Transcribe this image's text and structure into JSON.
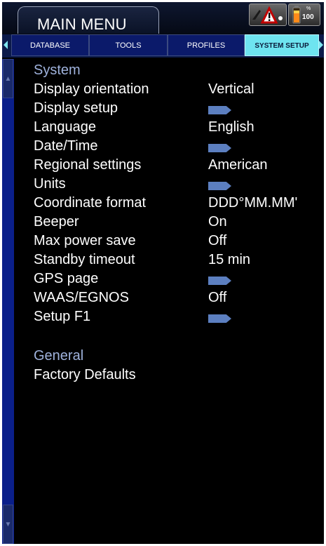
{
  "header": {
    "title": "MAIN MENU",
    "status_icons": [
      "warning-icon",
      "battery-icon"
    ],
    "battery_level": "100"
  },
  "tabs": [
    {
      "label": "DATABASE",
      "active": false
    },
    {
      "label": "TOOLS",
      "active": false
    },
    {
      "label": "PROFILES",
      "active": false
    },
    {
      "label": "SYSTEM SETUP",
      "active": true
    }
  ],
  "sections": {
    "system": {
      "title": "System",
      "items": [
        {
          "label": "Display orientation",
          "value": "Vertical"
        },
        {
          "label": "Display setup",
          "value": null,
          "icon": "submenu-arrow-icon"
        },
        {
          "label": "Language",
          "value": "English"
        },
        {
          "label": "Date/Time",
          "value": null,
          "icon": "submenu-arrow-icon"
        },
        {
          "label": "Regional settings",
          "value": "American"
        },
        {
          "label": "Units",
          "value": null,
          "icon": "submenu-arrow-icon"
        },
        {
          "label": "Coordinate format",
          "value": "DDD°MM.MM'"
        },
        {
          "label": "Beeper",
          "value": "On"
        },
        {
          "label": "Max power save",
          "value": "Off"
        },
        {
          "label": "Standby timeout",
          "value": "15 min"
        },
        {
          "label": "GPS page",
          "value": null,
          "icon": "submenu-arrow-icon"
        },
        {
          "label": "WAAS/EGNOS",
          "value": "Off"
        },
        {
          "label": "Setup F1",
          "value": null,
          "icon": "submenu-arrow-icon"
        }
      ]
    },
    "general": {
      "title": "General",
      "items": [
        {
          "label": "Factory Defaults"
        }
      ]
    }
  },
  "colors": {
    "background": "#000000",
    "section_title": "#9fb2dc",
    "active_tab": "#6ee4f0",
    "tab": "#0b1a6a",
    "submenu_arrow": "#5c7fc0",
    "scrollbar": "#0a1f8a"
  }
}
